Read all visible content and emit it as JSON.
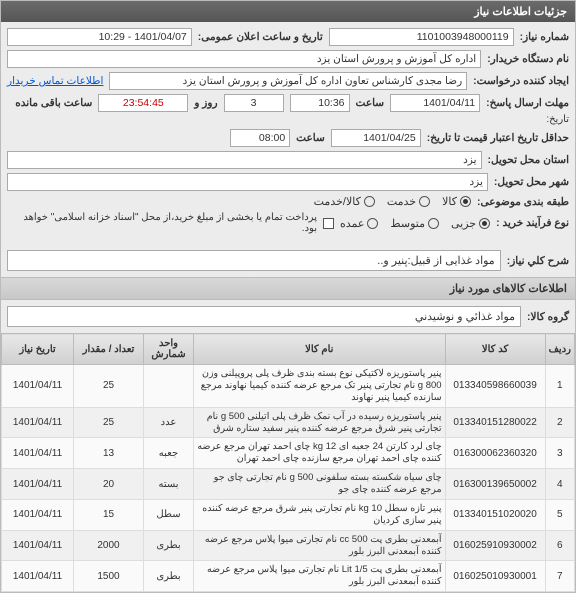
{
  "panel_title": "جزئیات اطلاعات نیاز",
  "labels": {
    "need_no": "شماره نیاز:",
    "announce_dt": "تاریخ و ساعت اعلان عمومی:",
    "buyer_org": "نام دستگاه خریدار:",
    "creator": "ایجاد کننده درخواست:",
    "contact_link": "اطلاعات تماس خریدار",
    "deadline": "مهلت ارسال پاسخ:",
    "date_word": "تاریخ:",
    "time_word": "ساعت",
    "remain_days_mid": "روز و",
    "remain_suffix": "ساعت باقی مانده",
    "validity": "حداقل تاریخ اعتبار قیمت تا تاریخ:",
    "deliver_province": "استان محل تحویل:",
    "deliver_city": "شهر محل تحویل:",
    "category": "طبقه بندی موضوعی:",
    "process": "نوع فرآیند خرید :",
    "payment_note": "پرداخت تمام یا بخشی از مبلغ خرید،از محل \"اسناد خزانه اسلامی\" خواهد بود.",
    "need_desc": "شرح کلي نیاز:",
    "items_info": "اطلاعات کالاهای مورد نیاز",
    "group": "گروه کالا:"
  },
  "values": {
    "need_no": "1101003948000119",
    "announce_dt": "1401/04/07 - 10:29",
    "buyer_org": "اداره کل آموزش و پرورش استان یزد",
    "creator": "رضا مجدی کارشناس تعاون اداره کل آموزش و پرورش استان یزد",
    "deadline_date": "1401/04/11",
    "deadline_time": "10:36",
    "remain_days": "3",
    "remain_time": "23:54:45",
    "validity_date": "1401/04/25",
    "validity_time": "08:00",
    "deliver_province": "یزد",
    "deliver_city": "یزد",
    "need_desc": "مواد غذایی از قبیل:پنیر و..",
    "group": "مواد غذائي و نوشیدني"
  },
  "category_options": [
    "کالا",
    "خدمت",
    "کالا/خدمت"
  ],
  "category_selected": 0,
  "process_options": [
    "جزیی",
    "متوسط",
    "عمده"
  ],
  "process_selected": 0,
  "table": {
    "headers": [
      "ردیف",
      "کد کالا",
      "نام کالا",
      "واحد شمارش",
      "تعداد / مقدار",
      "تاریخ نیاز"
    ],
    "rows": [
      {
        "idx": "1",
        "code": "013340598660039",
        "name": "پنیر پاستوریزه لاکتیکی نوع بسته بندی ظرف پلی پروپیلنی وزن g 800 نام تجارتی پنیر تک مرجع عرضه کننده کیمیا نهاوند مرجع سازنده کیمیا پنیر نهاوند",
        "unit": "",
        "qty": "25",
        "date": "1401/04/11"
      },
      {
        "idx": "2",
        "code": "013340151280022",
        "name": "پنیر پاستوریزه رسیده در آب نمک ظرف پلی اتیلنی g 500 نام تجارتی پنیر شرق مرجع عرضه کننده پنیر سفید ستاره شرق",
        "unit": "عدد",
        "qty": "25",
        "date": "1401/04/11"
      },
      {
        "idx": "3",
        "code": "016300062360320",
        "name": "چای لرد کارتن 24 جعبه ای kg 12 چای احمد تهران مرجع عرضه کننده چای احمد تهران مرجع سازنده چای احمد تهران",
        "unit": "جعبه",
        "qty": "13",
        "date": "1401/04/11"
      },
      {
        "idx": "4",
        "code": "016300139650002",
        "name": "چای سیاه شکسته بسته سلفونی g 500 نام تجارتی چای جو مرجع عرضه کننده چای جو",
        "unit": "بسته",
        "qty": "20",
        "date": "1401/04/11"
      },
      {
        "idx": "5",
        "code": "013340151020020",
        "name": "پنیر تازه سطل kg 10 نام تجارتی پنیر شرق مرجع عرضه کننده پنیر سازی کردیان",
        "unit": "سطل",
        "qty": "15",
        "date": "1401/04/11"
      },
      {
        "idx": "6",
        "code": "016025910930002",
        "name": "آبمعدنی بطری پت cc 500 نام تجارتی میوا پلاس مرجع عرضه کننده آبمعدنی البرز بلور",
        "unit": "بطری",
        "qty": "2000",
        "date": "1401/04/11"
      },
      {
        "idx": "7",
        "code": "016025010930001",
        "name": "آبمعدنی بطری پت Lit 1/5 نام تجارتی میوا پلاس مرجع عرضه کننده آبمعدنی البرز بلور",
        "unit": "بطری",
        "qty": "1500",
        "date": "1401/04/11"
      }
    ]
  }
}
